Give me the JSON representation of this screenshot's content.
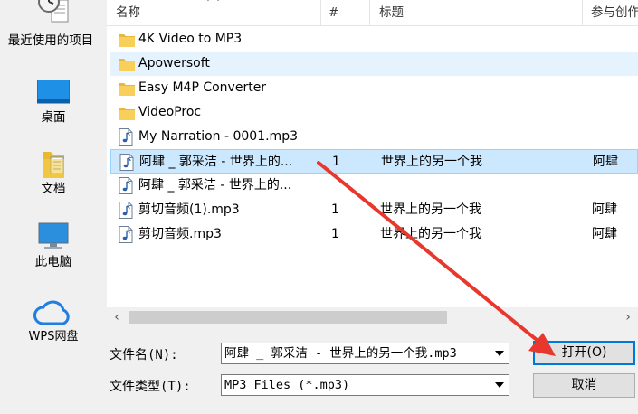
{
  "nav": {
    "items": [
      {
        "label": "最近使用的项目",
        "icon": "recent-items-icon"
      },
      {
        "label": "桌面",
        "icon": "desktop-icon"
      },
      {
        "label": "文档",
        "icon": "documents-icon"
      },
      {
        "label": "此电脑",
        "icon": "this-pc-icon"
      },
      {
        "label": "WPS网盘",
        "icon": "cloud-icon"
      }
    ]
  },
  "list": {
    "columns": {
      "name": "名称",
      "number": "#",
      "title": "标题",
      "artist": "参与创作"
    },
    "rows": [
      {
        "name": "4K Video to MP3",
        "type": "folder",
        "number": "",
        "title": "",
        "artist": ""
      },
      {
        "name": "Apowersoft",
        "type": "folder",
        "number": "",
        "title": "",
        "artist": ""
      },
      {
        "name": "Easy M4P Converter",
        "type": "folder",
        "number": "",
        "title": "",
        "artist": ""
      },
      {
        "name": "VideoProc",
        "type": "folder",
        "number": "",
        "title": "",
        "artist": ""
      },
      {
        "name": "My Narration - 0001.mp3",
        "type": "audio",
        "number": "",
        "title": "",
        "artist": ""
      },
      {
        "name": "阿肆 _ 郭采洁 - 世界上的...",
        "type": "audio",
        "number": "1",
        "title": "世界上的另一个我",
        "artist": "阿肆"
      },
      {
        "name": "阿肆 _ 郭采洁 - 世界上的...",
        "type": "audio",
        "number": "",
        "title": "",
        "artist": ""
      },
      {
        "name": "剪切音频(1).mp3",
        "type": "audio",
        "number": "1",
        "title": "世界上的另一个我",
        "artist": "阿肆"
      },
      {
        "name": "剪切音频.mp3",
        "type": "audio",
        "number": "1",
        "title": "世界上的另一个我",
        "artist": "阿肆"
      }
    ],
    "hover_index": 1,
    "selected_index": 5
  },
  "form": {
    "filename_label": "文件名(N):",
    "filename_value": "阿肆 _ 郭采洁 - 世界上的另一个我.mp3",
    "filetype_label": "文件类型(T):",
    "filetype_value": "MP3 Files (*.mp3)",
    "open_label": "打开(O)",
    "cancel_label": "取消"
  },
  "colors": {
    "annotation_arrow": "#e8372c",
    "selection": "#cce8ff",
    "accent": "#0078d7"
  }
}
